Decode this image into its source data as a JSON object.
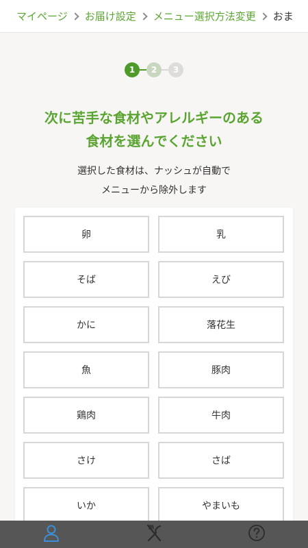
{
  "breadcrumb": {
    "items": [
      "マイページ",
      "お届け設定",
      "メニュー選択方法変更"
    ],
    "current": "おま"
  },
  "stepper": {
    "steps": [
      "1",
      "2",
      "3"
    ],
    "active_step": 1
  },
  "heading": {
    "line1": "次に苦手な食材やアレルギーのある",
    "line2": "食材を選んでください"
  },
  "description": {
    "line1": "選択した食材は、ナッシュが自動で",
    "line2": "メニューから除外します"
  },
  "ingredients": [
    {
      "label": "卵"
    },
    {
      "label": "乳"
    },
    {
      "label": "そば"
    },
    {
      "label": "えび"
    },
    {
      "label": "かに"
    },
    {
      "label": "落花生"
    },
    {
      "label": "魚"
    },
    {
      "label": "豚肉"
    },
    {
      "label": "鶏肉"
    },
    {
      "label": "牛肉"
    },
    {
      "label": "さけ"
    },
    {
      "label": "さば"
    },
    {
      "label": "いか"
    },
    {
      "label": "やまいも"
    }
  ],
  "bottom_nav": {
    "icons": [
      "user-icon",
      "utensils-icon",
      "help-icon"
    ],
    "active": "user-icon"
  },
  "colors": {
    "accent": "#5aa531",
    "active_step": "#4f9a2b",
    "nav_bg": "#565656",
    "nav_active_icon": "#3a8fd8"
  }
}
